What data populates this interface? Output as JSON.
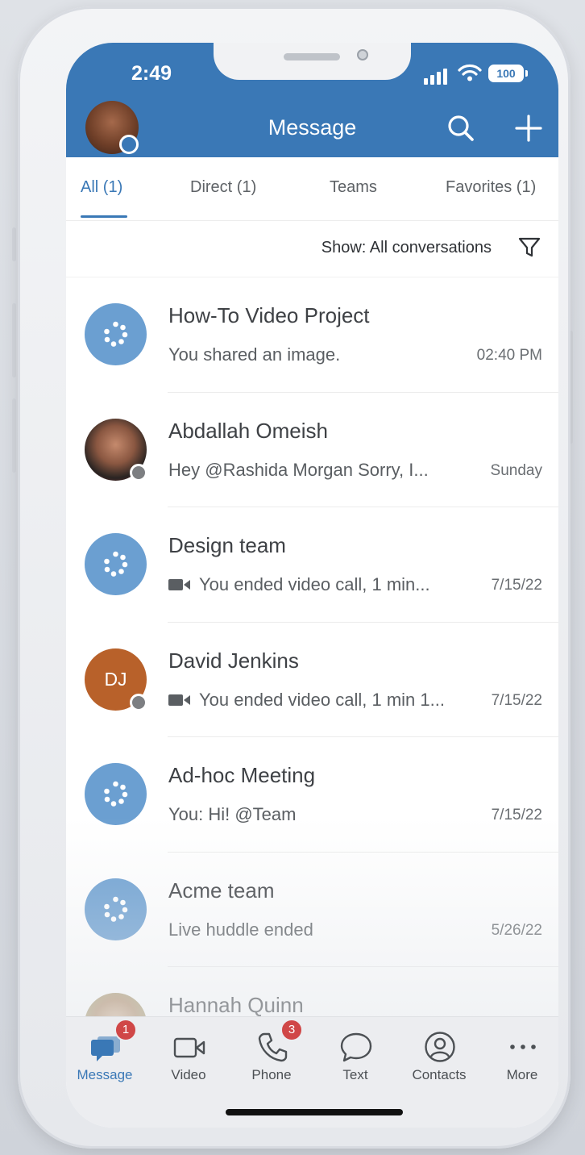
{
  "status_bar": {
    "time": "2:49",
    "battery": "100"
  },
  "header": {
    "title": "Message"
  },
  "tabs": [
    {
      "label": "All (1)",
      "active": true
    },
    {
      "label": "Direct (1)",
      "active": false
    },
    {
      "label": "Teams",
      "active": false
    },
    {
      "label": "Favorites (1)",
      "active": false
    }
  ],
  "filter": {
    "label": "Show: All conversations"
  },
  "conversations": [
    {
      "title": "How-To Video Project",
      "subtitle": "You shared an image.",
      "time": "02:40 PM",
      "avatar": "group-icon"
    },
    {
      "title": "Abdallah Omeish",
      "subtitle": "Hey @Rashida Morgan Sorry, I...",
      "time": "Sunday",
      "avatar": "photo"
    },
    {
      "title": "Design team",
      "subtitle": "You ended video call, 1 min...",
      "time": "7/15/22",
      "avatar": "group-icon",
      "icon": "video-camera-icon"
    },
    {
      "title": "David Jenkins",
      "subtitle": "You ended video call, 1 min 1...",
      "time": "7/15/22",
      "avatar": "initials",
      "initials": "DJ",
      "icon": "video-camera-icon"
    },
    {
      "title": "Ad-hoc Meeting",
      "subtitle": "You: Hi! @Team",
      "time": "7/15/22",
      "avatar": "group-icon"
    },
    {
      "title": "Acme team",
      "subtitle": "Live huddle ended",
      "time": "5/26/22",
      "avatar": "group-icon"
    },
    {
      "title": "Hannah Quinn",
      "avatar": "photo"
    }
  ],
  "bottom_nav": [
    {
      "label": "Message",
      "badge": "1",
      "active": true
    },
    {
      "label": "Video"
    },
    {
      "label": "Phone",
      "badge": "3"
    },
    {
      "label": "Text"
    },
    {
      "label": "Contacts"
    },
    {
      "label": "More"
    }
  ],
  "colors": {
    "brand_blue": "#3a78b6",
    "group_avatar": "#6b9fd1",
    "dj_avatar": "#b8612a",
    "badge_red": "#d04747"
  }
}
